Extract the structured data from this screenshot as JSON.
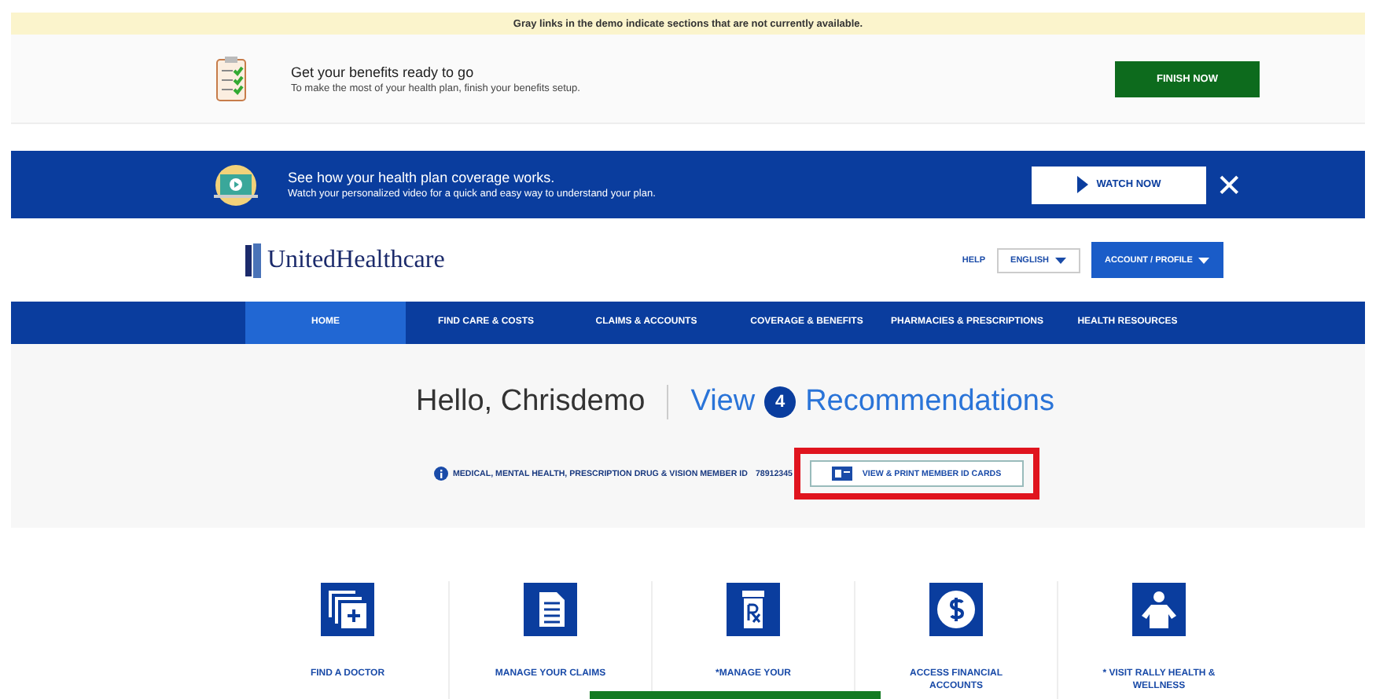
{
  "notice": "Gray links in the demo indicate sections that are not currently available.",
  "benefits_banner": {
    "title": "Get your benefits ready to go",
    "subtitle": "To make the most of your health plan, finish your benefits setup.",
    "button": "FINISH NOW"
  },
  "video_banner": {
    "title": "See how your health plan coverage works.",
    "subtitle": "Watch your personalized video for a quick and easy way to understand your plan.",
    "button": "WATCH NOW",
    "close": "✕"
  },
  "header": {
    "logo": "UnitedHealthcare",
    "help": "HELP",
    "language": "ENGLISH",
    "account": "ACCOUNT / PROFILE"
  },
  "nav": [
    {
      "label": "HOME",
      "selected": true
    },
    {
      "label": "FIND CARE & COSTS",
      "selected": false
    },
    {
      "label": "CLAIMS & ACCOUNTS",
      "selected": false
    },
    {
      "label": "COVERAGE & BENEFITS",
      "selected": false
    },
    {
      "label": "PHARMACIES & PRESCRIPTIONS",
      "selected": false
    },
    {
      "label": "HEALTH RESOURCES",
      "selected": false
    }
  ],
  "greeting": {
    "hello": "Hello, Chrisdemo",
    "view": "View",
    "count": "4",
    "recommendations": "Recommendations"
  },
  "member": {
    "text": "MEDICAL, MENTAL HEALTH, PRESCRIPTION DRUG & VISION MEMBER ID",
    "id": "78912345",
    "button": "VIEW & PRINT MEMBER ID CARDS",
    "highlighted": true
  },
  "tiles": [
    {
      "kind": "doctor",
      "label": "FIND A DOCTOR"
    },
    {
      "kind": "claims",
      "label": "MANAGE YOUR CLAIMS"
    },
    {
      "kind": "rx",
      "label": "*MANAGE YOUR"
    },
    {
      "kind": "money",
      "label": "ACCESS FINANCIAL ACCOUNTS"
    },
    {
      "kind": "wellness",
      "label": "* VISIT RALLY HEALTH & WELLNESS"
    }
  ]
}
